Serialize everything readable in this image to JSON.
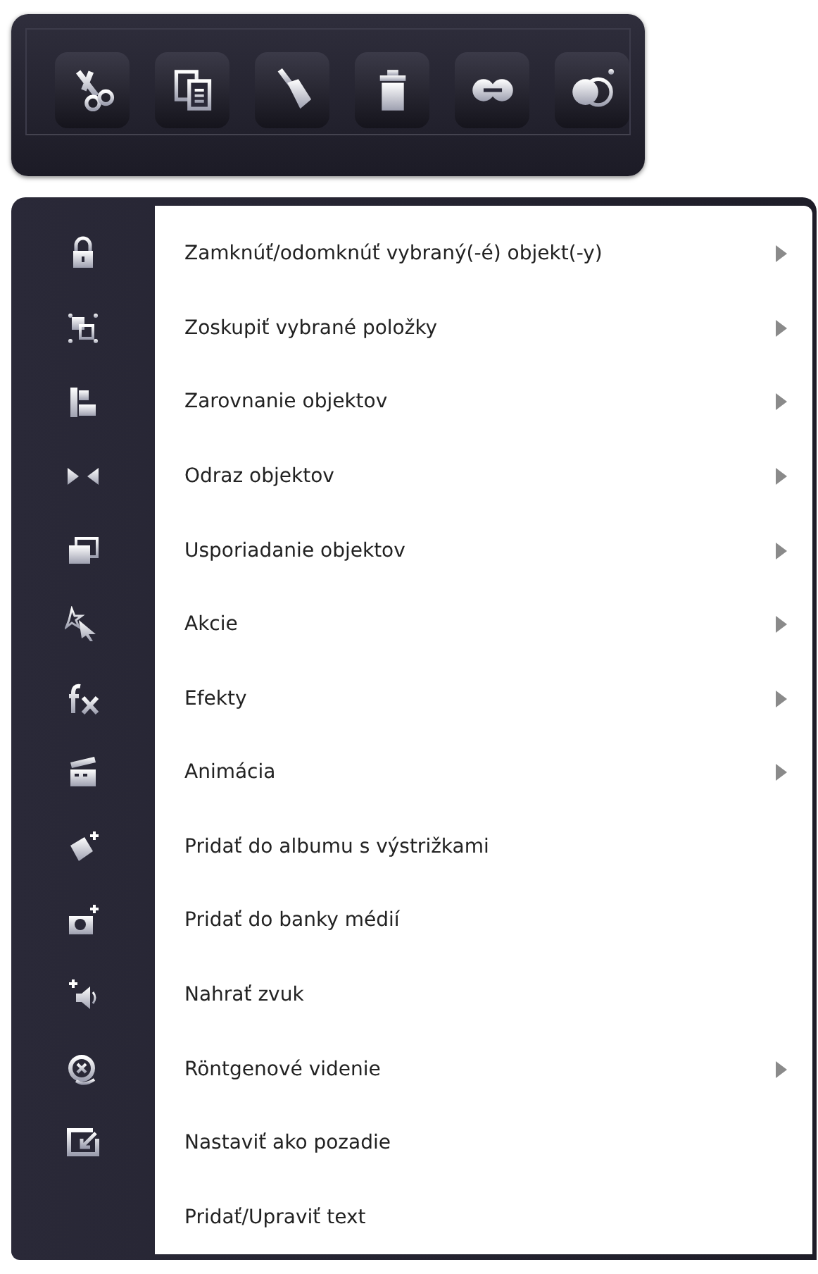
{
  "toolbar": {
    "buttons": [
      {
        "kind": "cut"
      },
      {
        "kind": "copy"
      },
      {
        "kind": "brush"
      },
      {
        "kind": "delete"
      },
      {
        "kind": "link"
      },
      {
        "kind": "blend"
      }
    ]
  },
  "menu": {
    "items": [
      {
        "label": "Zamknúť/odomknúť vybraný(-é) objekt(-y)",
        "submenu": true
      },
      {
        "label": "Zoskupiť vybrané položky",
        "submenu": true
      },
      {
        "label": "Zarovnanie objektov",
        "submenu": true
      },
      {
        "label": "Odraz objektov",
        "submenu": true
      },
      {
        "label": "Usporiadanie objektov",
        "submenu": true
      },
      {
        "label": "Akcie",
        "submenu": true
      },
      {
        "label": "Efekty",
        "submenu": true
      },
      {
        "label": "Animácia",
        "submenu": true
      },
      {
        "label": "Pridať do albumu s výstrižkami",
        "submenu": false
      },
      {
        "label": "Pridať do banky médií",
        "submenu": false
      },
      {
        "label": "Nahrať zvuk",
        "submenu": false
      },
      {
        "label": "Röntgenové videnie",
        "submenu": true
      },
      {
        "label": "Nastaviť ako pozadie",
        "submenu": false
      },
      {
        "label": "Pridať/Upraviť text",
        "submenu": false
      }
    ]
  }
}
